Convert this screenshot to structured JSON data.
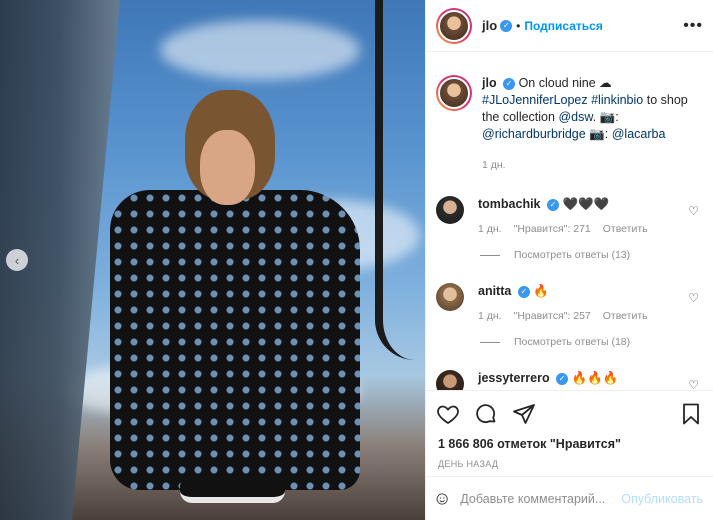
{
  "post": {
    "username": "jlo",
    "follow_label": "Подписаться",
    "dot": "•",
    "more": "•••"
  },
  "caption": {
    "username": "jlo",
    "text_plain": "On cloud nine ☁",
    "hashtags": "#JLoJenniferLopez #linkinbio",
    "text_after": "to shop the collection",
    "mention_dsw": "@dsw",
    "camera1": ". 📷:",
    "mention_photographer": "@richardburbridge",
    "camera2": "📷:",
    "mention_lacarba": "@lacarba",
    "time": "1 дн."
  },
  "comments": [
    {
      "username": "tombachik",
      "text": "🖤🖤🖤",
      "time": "1 дн.",
      "likes": "\"Нравится\": 271",
      "reply": "Ответить",
      "view_replies": "Посмотреть ответы (13)"
    },
    {
      "username": "anitta",
      "text": "🔥",
      "time": "1 дн.",
      "likes": "\"Нравится\": 257",
      "reply": "Ответить",
      "view_replies": "Посмотреть ответы (18)"
    },
    {
      "username": "jessyterrero",
      "text": "🔥🔥🔥"
    }
  ],
  "actions": {
    "likes_text": "1 866 806 отметок \"Нравится\"",
    "time": "ДЕНЬ НАЗАД",
    "comment_placeholder": "Добавьте комментарий...",
    "publish": "Опубликовать"
  },
  "icons": {
    "like": "heart-icon",
    "comment": "comment-icon",
    "share": "share-icon",
    "save": "bookmark-icon",
    "emoji": "emoji-icon",
    "prev": "chevron-left-icon"
  }
}
